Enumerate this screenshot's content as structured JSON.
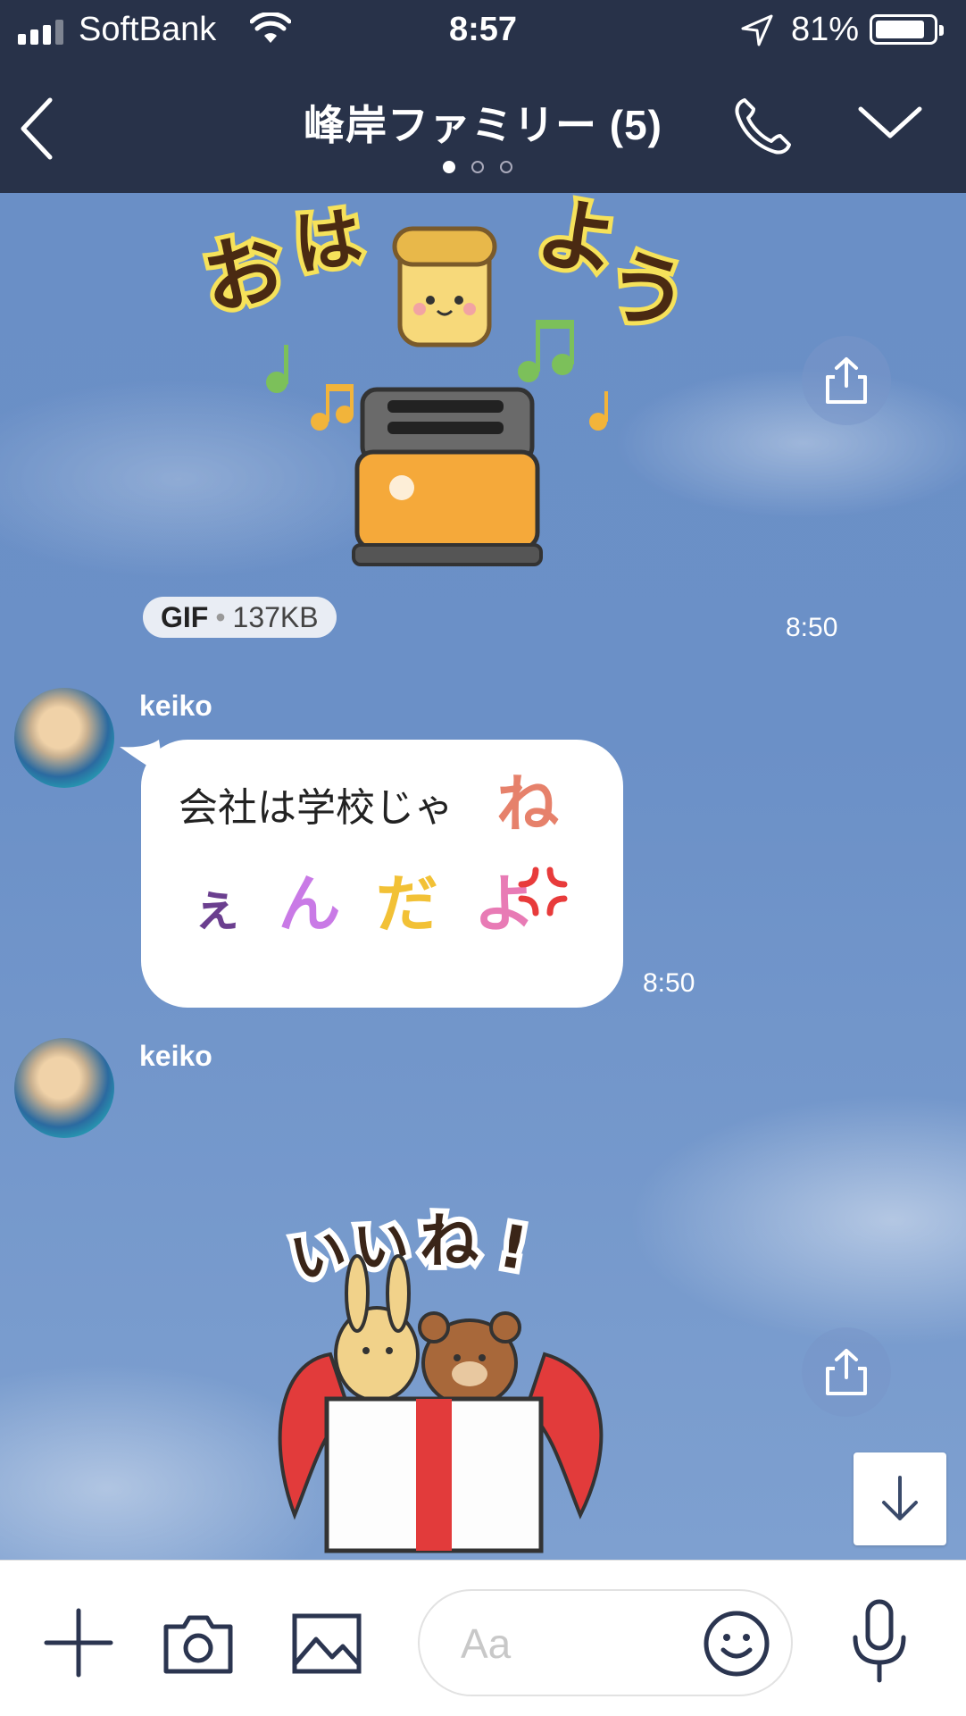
{
  "status_bar": {
    "carrier": "SoftBank",
    "time": "8:57",
    "battery_percent": "81%",
    "battery_level": 0.81
  },
  "header": {
    "title": "峰岸ファミリー (5)",
    "page_dots": 3,
    "active_dot": 0
  },
  "messages": [
    {
      "type": "gif_sticker",
      "sticker_text": "おはよう",
      "badge_label": "GIF",
      "badge_size": "137KB",
      "time": "8:50"
    },
    {
      "type": "text",
      "sender": "keiko",
      "line1": "会社は学校じゃ",
      "line1_emoji": "ね",
      "line2_chars": [
        "ぇ",
        "ん",
        "だ",
        "よ"
      ],
      "time": "8:50"
    },
    {
      "type": "sticker",
      "sender": "keiko",
      "sticker_text": "いいね!"
    }
  ],
  "composer": {
    "placeholder": "Aa"
  },
  "icons": {
    "back": "chevron-left-icon",
    "call": "phone-icon",
    "menu": "chevron-down-icon",
    "share": "share-icon",
    "scroll": "arrow-down-icon",
    "add": "plus-icon",
    "camera": "camera-icon",
    "image": "image-icon",
    "emoji": "smiley-icon",
    "mic": "microphone-icon"
  },
  "colors": {
    "nav_bg": "#283249",
    "chat_bg": "#6b90c7",
    "bubble_bg": "#ffffff"
  }
}
